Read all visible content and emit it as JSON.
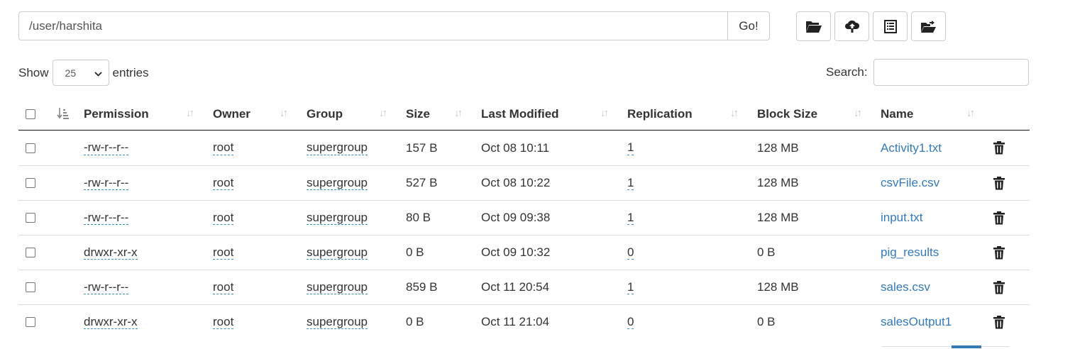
{
  "path": {
    "value": "/user/harshita",
    "go_label": "Go!"
  },
  "toolbar": [
    {
      "icon": "folder-open-icon",
      "name": "create-directory-button"
    },
    {
      "icon": "cloud-upload-icon",
      "name": "upload-button"
    },
    {
      "icon": "list-alt-icon",
      "name": "cut-paste-button"
    },
    {
      "icon": "folder-move-icon",
      "name": "move-button"
    }
  ],
  "length_menu": {
    "show_label": "Show",
    "selected": "25",
    "entries_label": "entries"
  },
  "search": {
    "label": "Search:",
    "value": ""
  },
  "table": {
    "columns": [
      "Permission",
      "Owner",
      "Group",
      "Size",
      "Last Modified",
      "Replication",
      "Block Size",
      "Name"
    ],
    "rows": [
      {
        "permission": "-rw-r--r--",
        "owner": "root",
        "group": "supergroup",
        "size": "157 B",
        "modified": "Oct 08 10:11",
        "replication": "1",
        "block_size": "128 MB",
        "name": "Activity1.txt"
      },
      {
        "permission": "-rw-r--r--",
        "owner": "root",
        "group": "supergroup",
        "size": "527 B",
        "modified": "Oct 08 10:22",
        "replication": "1",
        "block_size": "128 MB",
        "name": "csvFile.csv"
      },
      {
        "permission": "-rw-r--r--",
        "owner": "root",
        "group": "supergroup",
        "size": "80 B",
        "modified": "Oct 09 09:38",
        "replication": "1",
        "block_size": "128 MB",
        "name": "input.txt"
      },
      {
        "permission": "drwxr-xr-x",
        "owner": "root",
        "group": "supergroup",
        "size": "0 B",
        "modified": "Oct 09 10:32",
        "replication": "0",
        "block_size": "0 B",
        "name": "pig_results"
      },
      {
        "permission": "-rw-r--r--",
        "owner": "root",
        "group": "supergroup",
        "size": "859 B",
        "modified": "Oct 11 20:54",
        "replication": "1",
        "block_size": "128 MB",
        "name": "sales.csv"
      },
      {
        "permission": "drwxr-xr-x",
        "owner": "root",
        "group": "supergroup",
        "size": "0 B",
        "modified": "Oct 11 21:04",
        "replication": "0",
        "block_size": "0 B",
        "name": "salesOutput1"
      }
    ]
  },
  "colors": {
    "link": "#337ab7",
    "border": "#cccccc",
    "row_divider": "#dddddd",
    "header_divider": "#111111",
    "sort_icon": "#c8c8c8"
  }
}
